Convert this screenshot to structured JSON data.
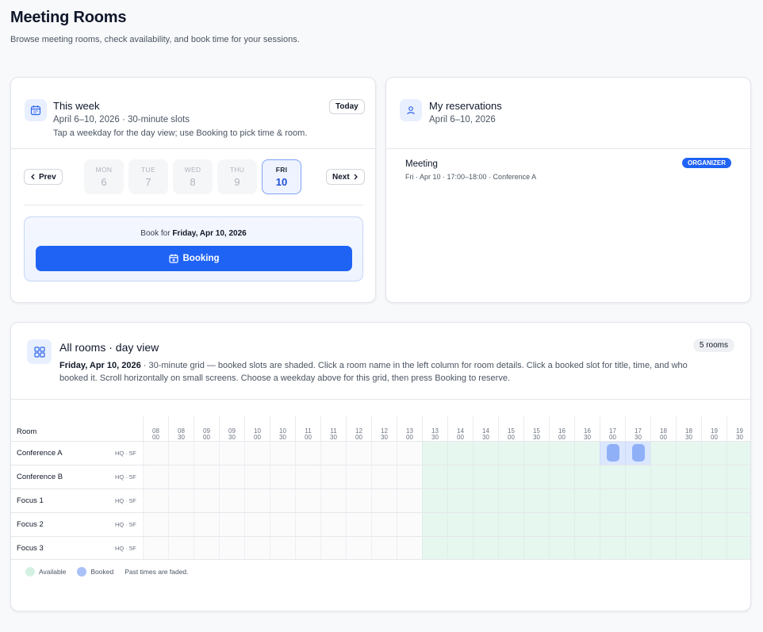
{
  "page": {
    "title": "Meeting Rooms",
    "subtitle": "Browse meeting rooms, check availability, and book time for your sessions."
  },
  "week": {
    "title": "This week",
    "range": "April 6–10, 2026 · 30-minute slots",
    "note": "Tap a weekday for the day view; use Booking to pick time & room.",
    "today_label": "Today",
    "prev_label": "Prev",
    "next_label": "Next",
    "days": [
      {
        "dow": "MON",
        "num": "6",
        "active": false
      },
      {
        "dow": "TUE",
        "num": "7",
        "active": false
      },
      {
        "dow": "WED",
        "num": "8",
        "active": false
      },
      {
        "dow": "THU",
        "num": "9",
        "active": false
      },
      {
        "dow": "FRI",
        "num": "10",
        "active": true
      }
    ],
    "book_for_prefix": "Book for",
    "book_for_date": "Friday, Apr 10, 2026",
    "booking_label": "Booking"
  },
  "reservations": {
    "title": "My reservations",
    "range": "April 6–10, 2026",
    "items": [
      {
        "title": "Meeting",
        "detail": "Fri · Apr 10 · 17:00–18:00 · Conference A",
        "badge": "ORGANIZER"
      }
    ]
  },
  "day_view": {
    "title": "All rooms · day view",
    "count_badge": "5 rooms",
    "date": "Friday, Apr 10, 2026",
    "description": " · 30-minute grid — booked slots are shaded. Click a room name in the left column for room details. Click a booked slot for title, time, and who booked it. Scroll horizontally on small screens. Choose a weekday above for this grid, then press Booking to reserve.",
    "room_header": "Room",
    "times": [
      [
        "08",
        "00"
      ],
      [
        "08",
        "30"
      ],
      [
        "09",
        "00"
      ],
      [
        "09",
        "30"
      ],
      [
        "10",
        "00"
      ],
      [
        "10",
        "30"
      ],
      [
        "11",
        "00"
      ],
      [
        "11",
        "30"
      ],
      [
        "12",
        "00"
      ],
      [
        "12",
        "30"
      ],
      [
        "13",
        "00"
      ],
      [
        "13",
        "30"
      ],
      [
        "14",
        "00"
      ],
      [
        "14",
        "30"
      ],
      [
        "15",
        "00"
      ],
      [
        "15",
        "30"
      ],
      [
        "16",
        "00"
      ],
      [
        "16",
        "30"
      ],
      [
        "17",
        "00"
      ],
      [
        "17",
        "30"
      ],
      [
        "18",
        "00"
      ],
      [
        "18",
        "30"
      ],
      [
        "19",
        "00"
      ],
      [
        "19",
        "30"
      ]
    ],
    "first_available_index": 11,
    "rooms": [
      {
        "name": "Conference A",
        "location": "HQ · 5F",
        "booked": [
          18,
          19
        ]
      },
      {
        "name": "Conference B",
        "location": "HQ · 5F",
        "booked": []
      },
      {
        "name": "Focus 1",
        "location": "HQ · 5F",
        "booked": []
      },
      {
        "name": "Focus 2",
        "location": "HQ · 5F",
        "booked": []
      },
      {
        "name": "Focus 3",
        "location": "HQ · 5F",
        "booked": []
      }
    ],
    "legend": {
      "available": "Available",
      "booked": "Booked",
      "note": "Past times are faded."
    }
  },
  "colors": {
    "accent": "#1f63f5",
    "available": "#e6f7ef",
    "booked": "#dbe6ff",
    "booked_chip": "#8fb0f7"
  },
  "icons": {
    "week": "calendar-icon",
    "reservations": "user-icon",
    "day_view": "grid-icon",
    "booking": "calendar-plus-icon"
  }
}
